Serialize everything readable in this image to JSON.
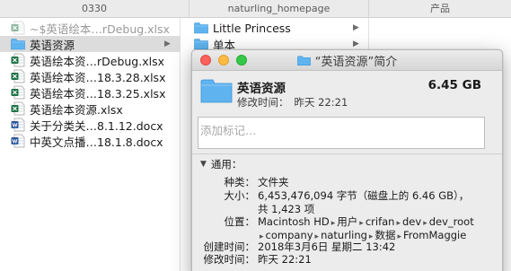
{
  "column_headers": [
    "0330",
    "naturling_homepage",
    "产品"
  ],
  "files": [
    {
      "name": "~$英语绘本…rDebug.xlsx",
      "icon": "excel-file-icon",
      "dim": true
    },
    {
      "name": "英语资源",
      "icon": "folder-icon",
      "selected": true,
      "has_children": true
    },
    {
      "name": "英语绘本资…rDebug.xlsx",
      "icon": "excel-file-icon"
    },
    {
      "name": "英语绘本资…18.3.28.xlsx",
      "icon": "excel-file-icon"
    },
    {
      "name": "英语绘本资…18.3.25.xlsx",
      "icon": "excel-file-icon"
    },
    {
      "name": "英语绘本资源.xlsx",
      "icon": "excel-file-icon"
    },
    {
      "name": "关于分类关…8.1.12.docx",
      "icon": "word-file-icon"
    },
    {
      "name": "中英文点播…18.1.8.docx",
      "icon": "word-file-icon"
    }
  ],
  "folders": [
    {
      "name": "Little Princess",
      "icon": "folder-icon"
    },
    {
      "name": "单本",
      "icon": "folder-icon"
    }
  ],
  "info": {
    "title": "“英语资源”简介",
    "name": "英语资源",
    "size": "6.45 GB",
    "modified_label": "修改时间：",
    "modified_value": "昨天 22:21",
    "tag_placeholder": "添加标记…",
    "general_label": "通用：",
    "kind_label": "种类：",
    "kind_value": "文件夹",
    "size_label": "大小：",
    "size_value_line1": "6,453,476,094 字节（磁盘上的 6.46 GB），",
    "size_value_line2": "共 1,423 项",
    "where_label": "位置：",
    "where_path_line1": [
      "Macintosh HD",
      "用户",
      "crifan",
      "dev",
      "dev_root"
    ],
    "where_path_line2": [
      "company",
      "naturling",
      "数据",
      "FromMaggie"
    ],
    "created_label": "创建时间：",
    "created_value": "2018年3月6日 星期二 13:42",
    "modified2_label": "修改时间：",
    "modified2_value": "昨天 22:21"
  },
  "colors": {
    "folder": "#5fb4f0",
    "excel": "#1e7145",
    "word": "#2b579a",
    "selected_row": "#dcdcdc"
  }
}
